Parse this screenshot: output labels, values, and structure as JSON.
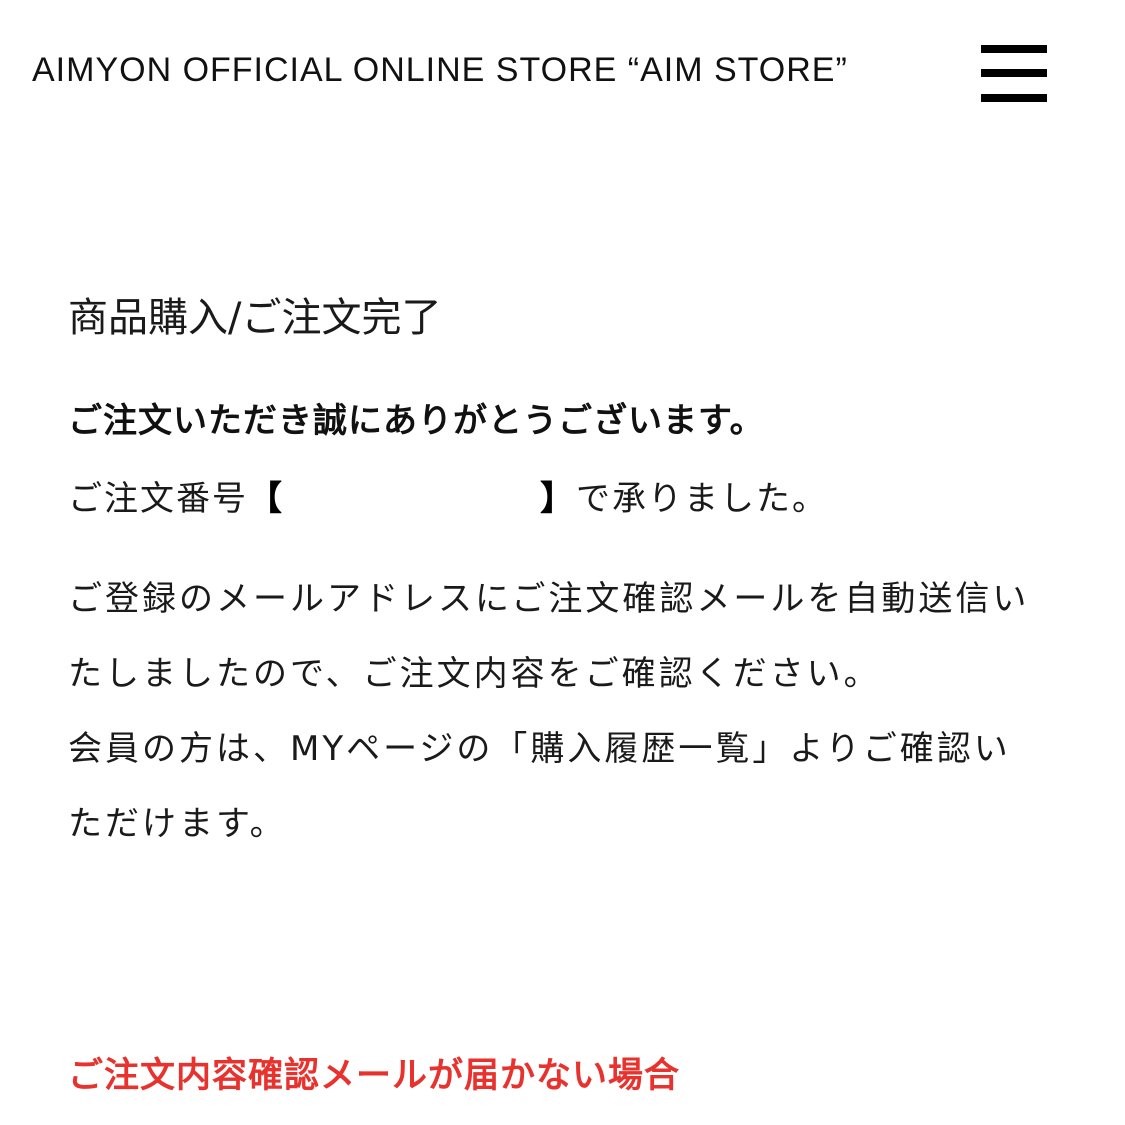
{
  "header": {
    "store_title": "AIMYON OFFICIAL ONLINE STORE “AIM STORE”",
    "menu_icon": "hamburger-menu-icon"
  },
  "main": {
    "page_title": "商品購入/ご注文完了",
    "thanks_message": "ご注文いただき誠にありがとうございます。",
    "order_prefix": "ご注文番号",
    "bracket_open": "【",
    "order_number": "",
    "bracket_close": "】",
    "order_suffix": "で承りました。",
    "email_notice": "ご登録のメールアドレスにご注文確認メールを自動送信いたしましたので、ご注文内容をご確認ください。",
    "member_notice": "会員の方は、MYページの「購入履歴一覧」よりご確認いただけます。",
    "email_not_received_heading": "ご注文内容確認メールが届かない場合"
  },
  "colors": {
    "warning": "#e8322e",
    "text": "#1a1a1a",
    "background": "#ffffff"
  }
}
